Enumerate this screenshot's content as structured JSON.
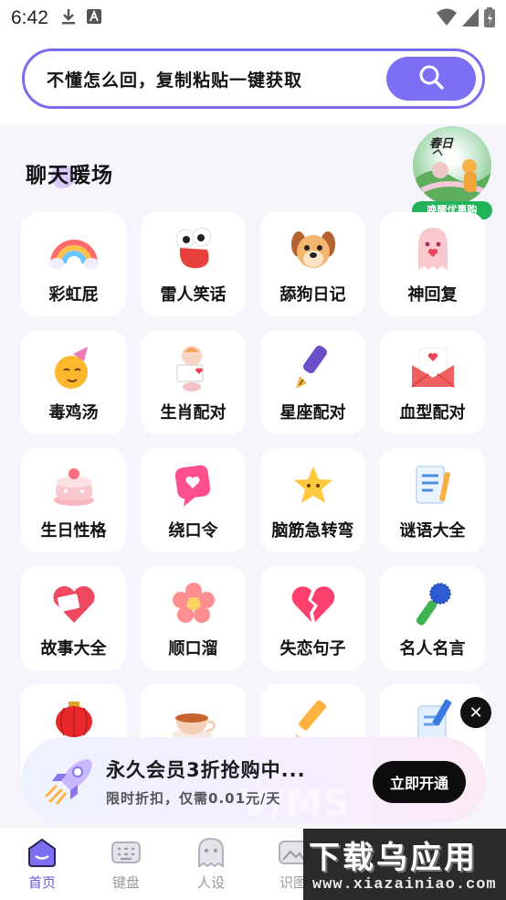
{
  "status_bar": {
    "time": "6:42"
  },
  "search": {
    "placeholder": "不懂怎么回，复制粘贴一键获取"
  },
  "section": {
    "title": "聊天暖场"
  },
  "promo": {
    "brand": "春日",
    "tag": "唤醒优惠购"
  },
  "features": [
    {
      "label": "彩虹屁",
      "icon": "rainbow-icon"
    },
    {
      "label": "雷人笑话",
      "icon": "laughing-face-icon"
    },
    {
      "label": "舔狗日记",
      "icon": "dog-icon"
    },
    {
      "label": "神回复",
      "icon": "ghost-heart-icon"
    },
    {
      "label": "毒鸡汤",
      "icon": "party-face-icon"
    },
    {
      "label": "生肖配对",
      "icon": "baby-icon"
    },
    {
      "label": "星座配对",
      "icon": "fountain-pen-icon"
    },
    {
      "label": "血型配对",
      "icon": "love-letter-icon"
    },
    {
      "label": "生日性格",
      "icon": "birthday-cake-icon"
    },
    {
      "label": "绕口令",
      "icon": "chat-heart-icon"
    },
    {
      "label": "脑筋急转弯",
      "icon": "star-icon"
    },
    {
      "label": "谜语大全",
      "icon": "notepad-icon"
    },
    {
      "label": "故事大全",
      "icon": "heart-envelope-icon"
    },
    {
      "label": "顺口溜",
      "icon": "flower-icon"
    },
    {
      "label": "失恋句子",
      "icon": "broken-heart-icon"
    },
    {
      "label": "名人名言",
      "icon": "microphone-icon"
    },
    {
      "label": "",
      "icon": "lantern-icon"
    },
    {
      "label": "",
      "icon": "teacup-icon"
    },
    {
      "label": "",
      "icon": "pencil-icon"
    },
    {
      "label": "",
      "icon": "document-edit-icon"
    }
  ],
  "banner": {
    "title": "永久会员3折抢购中...",
    "subtitle": "限时折扣，仅需0.01元/天",
    "cta": "立即开通",
    "watermark": "V/MS"
  },
  "tabs": [
    {
      "label": "首页",
      "icon": "home-icon",
      "active": true
    },
    {
      "label": "键盘",
      "icon": "keyboard-icon",
      "active": false
    },
    {
      "label": "人设",
      "icon": "persona-icon",
      "active": false
    },
    {
      "label": "识图",
      "icon": "image-icon",
      "active": false
    }
  ],
  "watermark": {
    "title": "下载乌应用",
    "url": "www.xiazainiao.com"
  },
  "colors": {
    "accent": "#7d6ff3",
    "background": "#f7f5fc",
    "cta": "#0d0d0d"
  }
}
